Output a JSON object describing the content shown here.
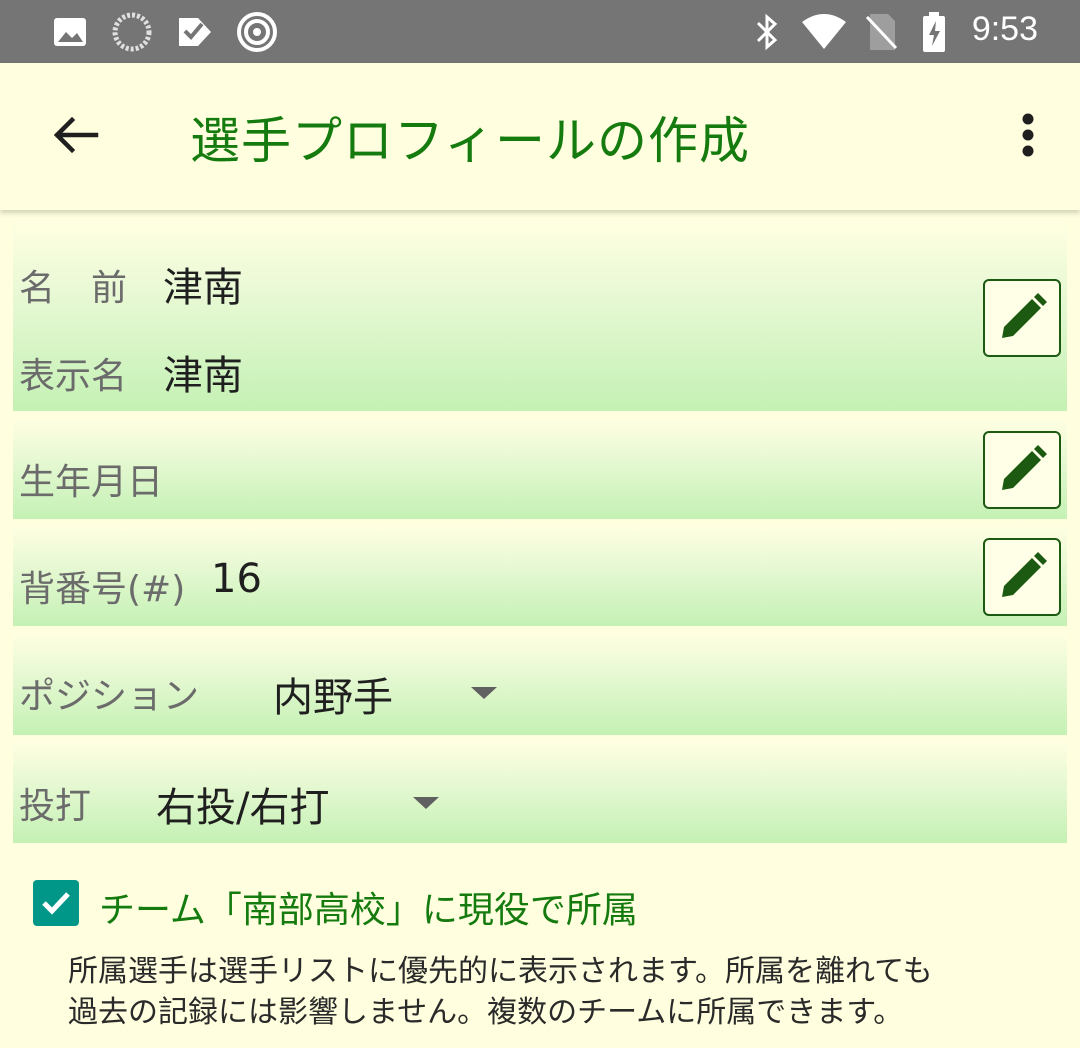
{
  "status_bar": {
    "time": "9:53",
    "left_icons": [
      "image-icon",
      "sync-icon",
      "task-icon",
      "target-icon"
    ],
    "right_icons": [
      "bluetooth-icon",
      "wifi-icon",
      "no-sim-icon",
      "battery-charging-icon"
    ]
  },
  "app_bar": {
    "title": "選手プロフィールの作成",
    "back_icon": "back-arrow-icon",
    "menu_icon": "more-vert-icon",
    "title_color": "#157b0f"
  },
  "form": {
    "name": {
      "label": "名　前",
      "value": "津南"
    },
    "display_name": {
      "label": "表示名",
      "value": "津南"
    },
    "birthday": {
      "label": "生年月日",
      "value": ""
    },
    "number": {
      "label": "背番号(#)",
      "value": "16"
    },
    "position": {
      "label": "ポジション",
      "value": "内野手"
    },
    "bat_throw": {
      "label": "投打",
      "value": "右投/右打"
    }
  },
  "membership": {
    "checked": true,
    "label": "チーム「南部高校」に現役で所属",
    "help_line1": "所属選手は選手リストに優先的に表示されます。所属を離れても",
    "help_line2": "過去の記録には影響しません。複数のチームに所属できます。"
  },
  "colors": {
    "accent_green": "#157b0f",
    "checkbox_teal": "#009688",
    "background": "#ffffdf"
  }
}
